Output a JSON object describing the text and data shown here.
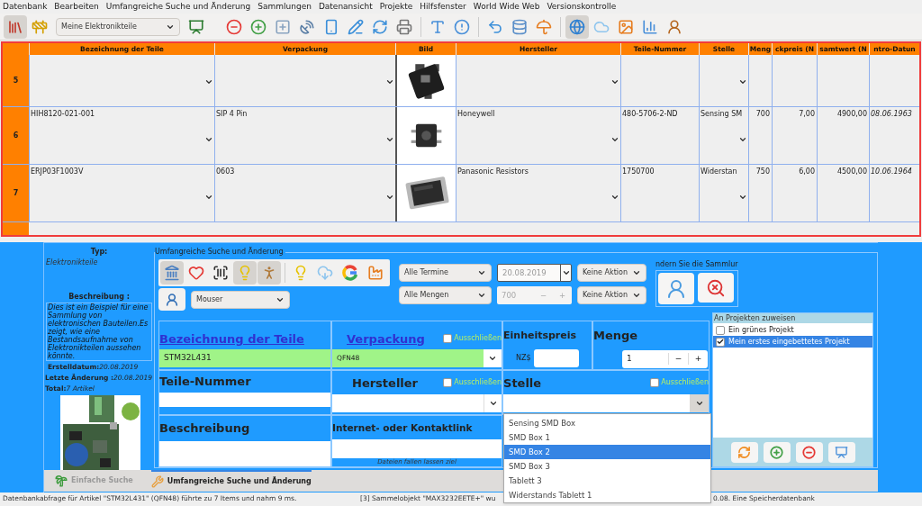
{
  "menu": [
    "Datenbank",
    "Bearbeiten",
    "Umfangreiche Suche und Änderung",
    "Sammlungen",
    "Datenansicht",
    "Projekte",
    "Hilfsfenster",
    "World Wide Web",
    "Versionskontrolle"
  ],
  "toolbar": {
    "collection": "Meine Elektronikteile",
    "buttons": [
      {
        "on": true
      },
      {
        "on": false
      },
      {
        "on": false
      },
      {
        "on": false
      },
      {
        "on": false
      },
      {
        "on": false
      },
      {
        "on": false
      },
      {
        "on": false
      },
      {
        "on": false
      },
      {
        "on": false
      },
      {
        "on": false
      },
      {
        "on": false
      },
      {
        "on": false
      },
      {
        "on": false
      },
      {
        "on": false
      },
      {
        "on": false
      },
      {
        "on": true
      },
      {
        "on": false
      },
      {
        "on": false
      },
      {
        "on": false
      },
      {
        "on": false
      }
    ]
  },
  "table": {
    "columns": [
      "Bezeichnung der Teile",
      "Verpackung",
      "Bild",
      "Hersteller",
      "Teile-Nummer",
      "Stelle",
      "Meng",
      "ckpreis (N",
      "samtwert (N",
      "ntro-Datun"
    ],
    "rows": [
      {
        "number": "5"
      },
      {
        "number": "6",
        "name": "HIH8120-021-001",
        "packaging": "SIP 4 Pin",
        "manufacturer": "Honeywell",
        "part_number": "480-5706-2-ND",
        "location": "Sensing SM",
        "quantity": "700",
        "unit_price": "7,00",
        "total": "4900,00",
        "intro_date": "08.06.1963"
      },
      {
        "number": "7",
        "name": "ERJP03F1003V",
        "packaging": "0603",
        "manufacturer": "Panasonic Resistors",
        "part_number": "1750700",
        "location": "Widerstan",
        "quantity": "750",
        "unit_price": "6,00",
        "total": "4500,00",
        "intro_date": "10.06.1964"
      }
    ]
  },
  "info": {
    "type_label": "Typ:",
    "type": "Elektronikteile",
    "description_label": "Beschreibung :",
    "description": "Dies ist ein Beispiel für eine Sammlung von elektronischen Bauteilen.Es zeigt, wie eine Bestandsaufnahme von Elektronikteilen aussehen könnte.",
    "created_label": "Erstelldatum:",
    "created": "20.08.2019",
    "changed_label": "Letzte Änderung :",
    "changed": "20.08.2019",
    "total_label": "Total:",
    "total": "7 Artikel"
  },
  "search": {
    "title": "Umfangreiche Suche und Änderung",
    "tool_buttons": [
      {
        "on": true
      },
      {
        "on": false
      },
      {
        "on": false
      },
      {
        "on": true
      },
      {
        "on": true
      },
      {
        "on": false
      },
      {
        "on": false
      },
      {
        "on": false
      },
      {
        "on": false
      }
    ],
    "supplier": "Mouser",
    "date_filter": "Alle Termine",
    "date": "20.08.2019",
    "date_action": "Keine Aktion",
    "quantity_filter": "Alle Mengen",
    "quantity": "700",
    "quantity_minus": "−",
    "quantity_plus": "+",
    "quantity_action": "Keine Aktion",
    "collection_hint": "ndern Sie die Sammlur",
    "fields": {
      "name": {
        "label": "Bezeichnung der Teile",
        "value": "STM32L431"
      },
      "packaging": {
        "label": "Verpackung",
        "value": "QFN48",
        "exclude_label": "Ausschließen",
        "exclude": false
      },
      "unit_price": {
        "label": "Einheitspreis",
        "currency": "NZ$"
      },
      "amount": {
        "label": "Menge",
        "value": "1",
        "minus": "−",
        "plus": "+"
      },
      "part_number": {
        "label": "Teile-Nummer"
      },
      "manufacturer": {
        "label": "Hersteller",
        "exclude_label": "Ausschließen",
        "exclude": false
      },
      "location": {
        "label": "Stelle",
        "exclude_label": "Ausschließen",
        "exclude": false,
        "open": true,
        "options": [
          {
            "label": "Sensing SMD Box",
            "selected": false
          },
          {
            "label": "SMD Box 1",
            "selected": false
          },
          {
            "label": "SMD Box 2",
            "selected": true
          },
          {
            "label": "SMD Box 3",
            "selected": false
          },
          {
            "label": "Tablett 3",
            "selected": false
          },
          {
            "label": "Widerstands Tablett 1",
            "selected": false
          }
        ]
      },
      "description": {
        "label": "Beschreibung"
      },
      "link": {
        "label": "Internet- oder Kontaktlink",
        "drop_hint": "Dateien fallen lassen ziel"
      }
    }
  },
  "projects": {
    "title": "An Projekten zuweisen",
    "items": [
      {
        "label": "Ein grünes Projekt",
        "checked": false,
        "selected": false
      },
      {
        "label": "Mein erstes eingebettetes Projekt",
        "checked": true,
        "selected": true
      }
    ]
  },
  "tabs": [
    {
      "label": "Einfache Suche",
      "selected": false
    },
    {
      "label": "Umfangreiche Suche und Änderung",
      "selected": true
    }
  ],
  "status": [
    "Datenbankabfrage für Artikel \"STM32L431\"  (QFN48) führte zu 7 Items und nahm 9 ms.",
    "[3] Sammelobjekt \"MAX3232EETE+\" wu",
    "0.08. Eine Speicherdatenbank"
  ]
}
